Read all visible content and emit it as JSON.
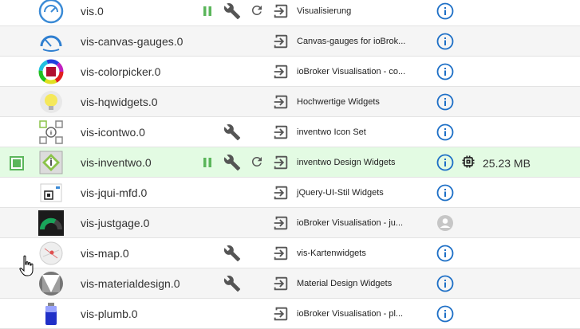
{
  "adapters": [
    {
      "name": "vis.0",
      "description": "Visualisierung",
      "logo": "vis-gauge-icon",
      "pause": true,
      "config": true,
      "reload": true,
      "info": "info-icon"
    },
    {
      "name": "vis-canvas-gauges.0",
      "description": "Canvas-gauges for ioBrok...",
      "logo": "canvas-gauge-icon",
      "pause": false,
      "config": false,
      "reload": false,
      "info": "info-icon"
    },
    {
      "name": "vis-colorpicker.0",
      "description": "ioBroker Visualisation - co...",
      "logo": "color-wheel-icon",
      "pause": false,
      "config": false,
      "reload": false,
      "info": "info-icon"
    },
    {
      "name": "vis-hqwidgets.0",
      "description": "Hochwertige Widgets",
      "logo": "lightbulb-icon",
      "pause": false,
      "config": false,
      "reload": false,
      "info": "info-icon"
    },
    {
      "name": "vis-icontwo.0",
      "description": "inventwo Icon Set",
      "logo": "inventwo-icon-set-icon",
      "pause": false,
      "config": true,
      "reload": false,
      "info": "info-icon"
    },
    {
      "name": "vis-inventwo.0",
      "description": "inventwo Design Widgets",
      "logo": "inventwo-logo-icon",
      "pause": true,
      "config": true,
      "reload": true,
      "info": "info-icon",
      "memory": "25.23 MB",
      "selected": true
    },
    {
      "name": "vis-jqui-mfd.0",
      "description": "jQuery-UI-Stil Widgets",
      "logo": "jqui-mfd-icon",
      "pause": false,
      "config": false,
      "reload": false,
      "info": "info-icon"
    },
    {
      "name": "vis-justgage.0",
      "description": "ioBroker Visualisation - ju...",
      "logo": "justgage-icon",
      "pause": false,
      "config": false,
      "reload": false,
      "info": "avatar-icon"
    },
    {
      "name": "vis-map.0",
      "description": "vis-Kartenwidgets",
      "logo": "map-icon",
      "pause": false,
      "config": true,
      "reload": false,
      "info": "info-icon"
    },
    {
      "name": "vis-materialdesign.0",
      "description": "Material Design Widgets",
      "logo": "material-design-icon",
      "pause": false,
      "config": true,
      "reload": false,
      "info": "info-icon"
    },
    {
      "name": "vis-plumb.0",
      "description": "ioBroker Visualisation - pl...",
      "logo": "battery-icon",
      "pause": false,
      "config": false,
      "reload": false,
      "info": "info-icon"
    }
  ],
  "colors": {
    "green": "#5bb65b",
    "icon_grey": "#555555",
    "info_blue": "#1d6fc6",
    "selected_row": "#e3fbe3",
    "alt_row": "#f5f5f5"
  }
}
